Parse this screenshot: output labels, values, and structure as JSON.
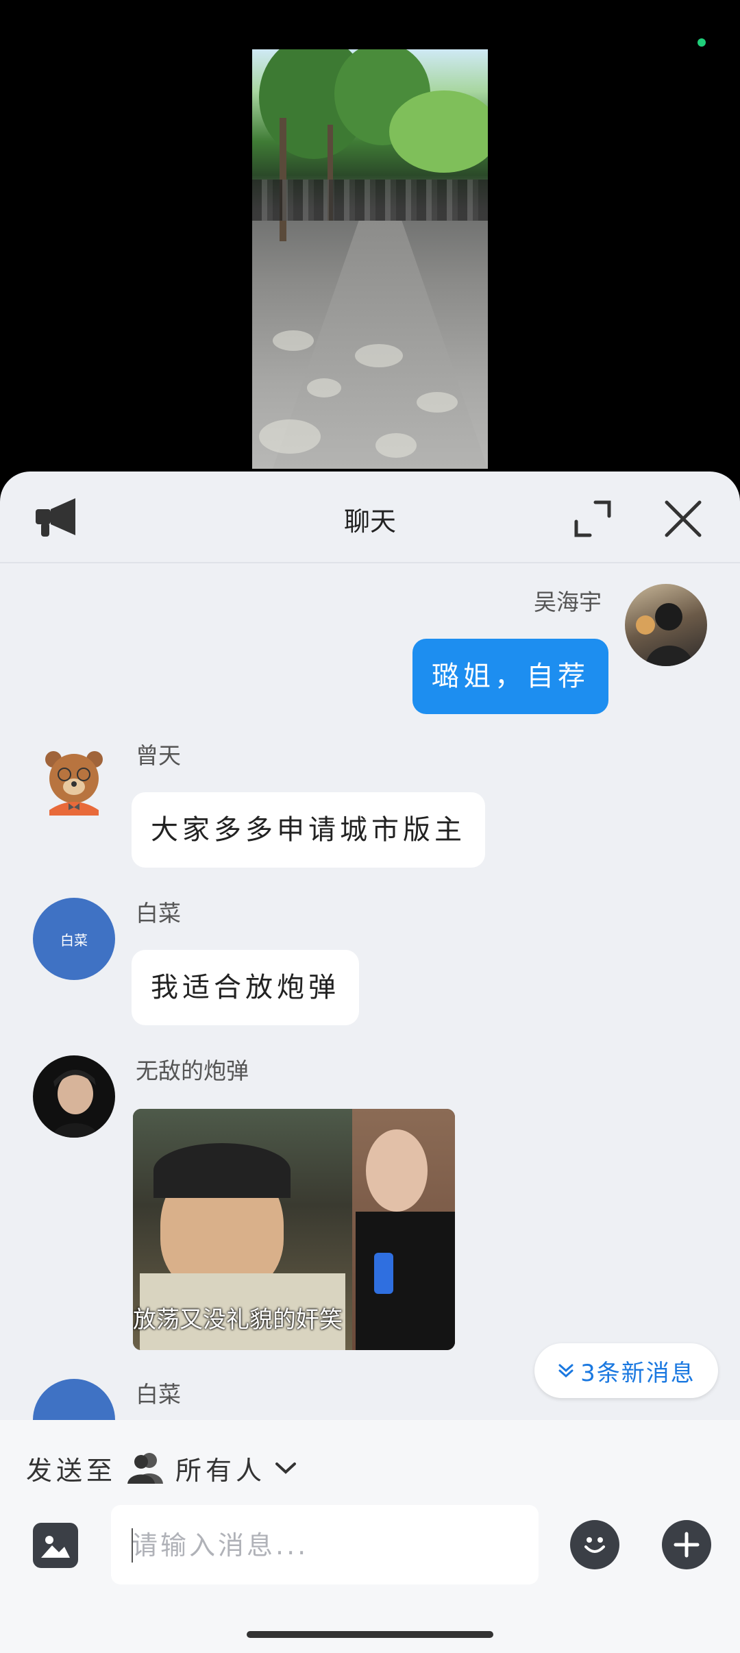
{
  "chat": {
    "title": "聊天",
    "messages": [
      {
        "sender": "吴海宇",
        "text": "璐姐，自荐",
        "mine": true
      },
      {
        "sender": "曾天",
        "text": "大家多多申请城市版主"
      },
      {
        "sender": "白菜",
        "avatar_text": "白菜",
        "text": "我适合放炮弹"
      },
      {
        "sender": "无敌的炮弹",
        "image_caption": "放荡又没礼貌的奸笑"
      },
      {
        "sender": "白菜"
      }
    ],
    "new_messages_label": "3条新消息"
  },
  "composer": {
    "send_to_label": "发送至",
    "recipient": "所有人",
    "placeholder": "请输入消息..."
  },
  "colors": {
    "accent": "#1d8ef0",
    "online_dot": "#1fcf7a",
    "avatar_blue": "#3f72c4"
  }
}
